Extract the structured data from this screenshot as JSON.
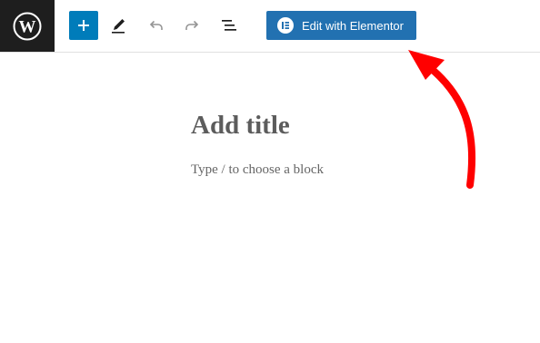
{
  "toolbar": {
    "logo_icon": "wordpress-logo-icon",
    "buttons": [
      {
        "name": "add-block-button",
        "icon": "plus-icon"
      },
      {
        "name": "tools-button",
        "icon": "pencil-icon"
      },
      {
        "name": "undo-button",
        "icon": "undo-icon"
      },
      {
        "name": "redo-button",
        "icon": "redo-icon"
      },
      {
        "name": "document-overview-button",
        "icon": "list-view-icon"
      }
    ],
    "elementor_button_label": "Edit with Elementor",
    "elementor_icon": "elementor-icon"
  },
  "editor": {
    "title_placeholder": "Add title",
    "block_placeholder": "Type / to choose a block"
  },
  "annotation": {
    "type": "arrow",
    "color": "#ff0000",
    "points_to": "Edit with Elementor"
  },
  "colors": {
    "logo_background": "#1e1e1e",
    "add_button": "#007cba",
    "elementor_button": "#2271b1",
    "title_text": "#5c5c5c",
    "placeholder_text": "#666666"
  }
}
